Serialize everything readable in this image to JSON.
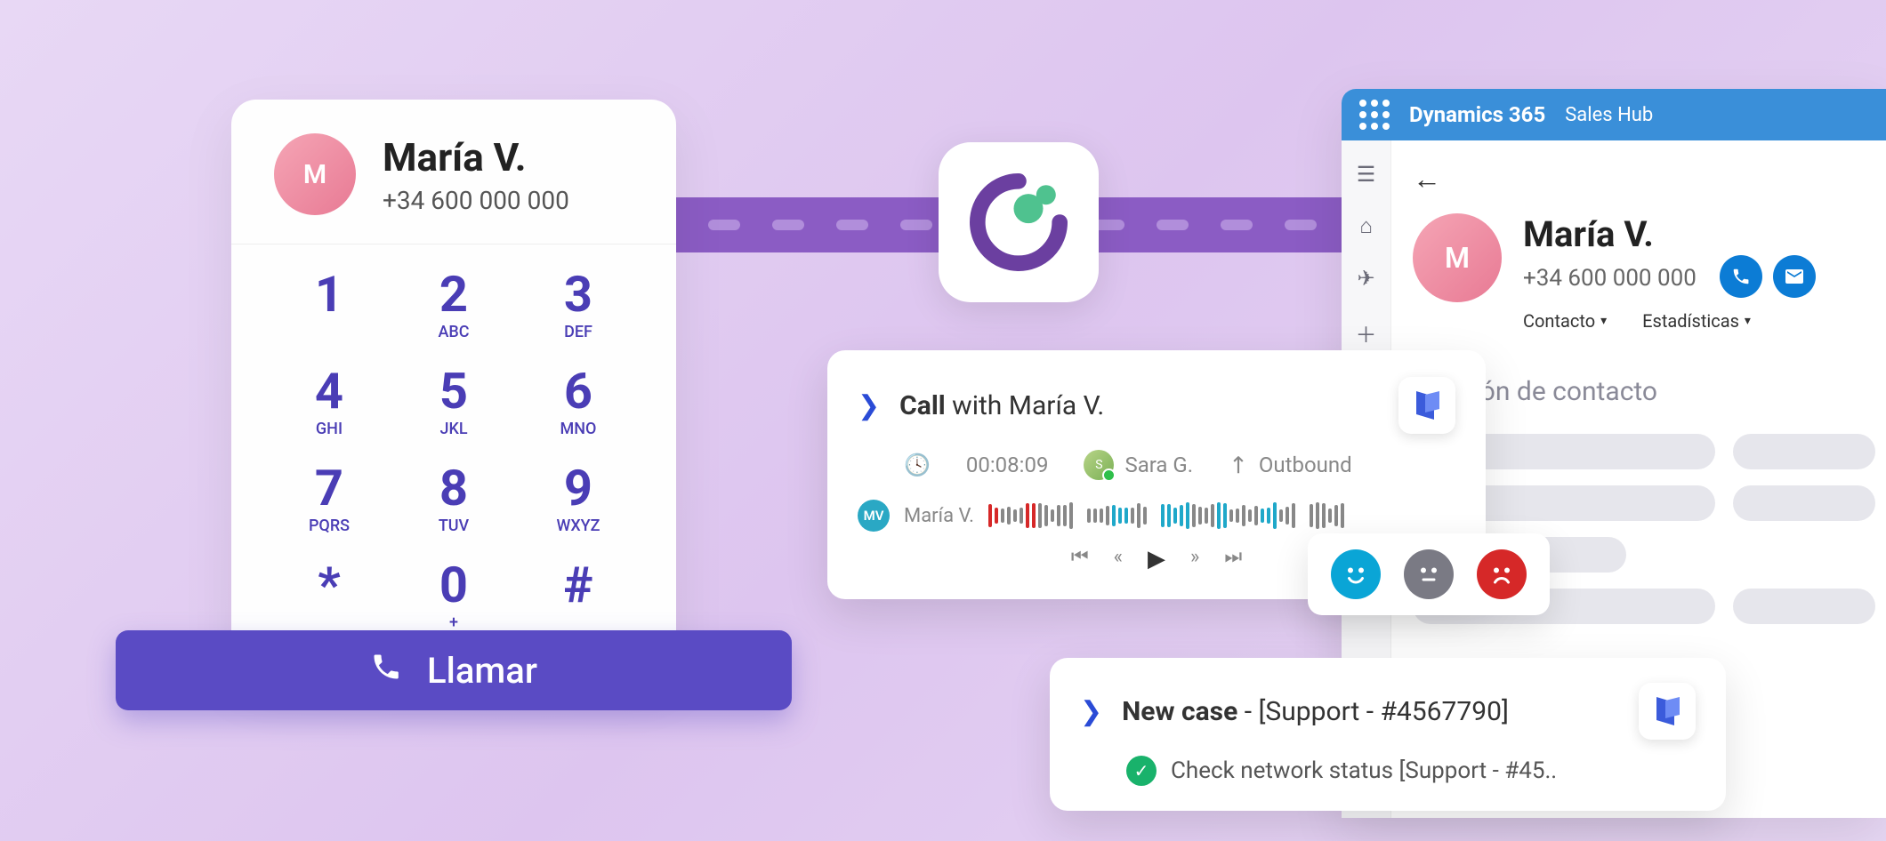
{
  "dialer": {
    "contact_name": "María V.",
    "contact_phone": "+34 600 000 000",
    "keys": [
      {
        "digit": "1",
        "letters": ""
      },
      {
        "digit": "2",
        "letters": "ABC"
      },
      {
        "digit": "3",
        "letters": "DEF"
      },
      {
        "digit": "4",
        "letters": "GHI"
      },
      {
        "digit": "5",
        "letters": "JKL"
      },
      {
        "digit": "6",
        "letters": "MNO"
      },
      {
        "digit": "7",
        "letters": "PQRS"
      },
      {
        "digit": "8",
        "letters": "TUV"
      },
      {
        "digit": "9",
        "letters": "WXYZ"
      },
      {
        "digit": "*",
        "letters": ""
      },
      {
        "digit": "0",
        "letters": "+"
      },
      {
        "digit": "#",
        "letters": ""
      }
    ],
    "call_label": "Llamar"
  },
  "dynamics": {
    "product": "Dynamics 365",
    "area": "Sales Hub",
    "contact_name": "María V.",
    "contact_phone": "+34 600 000 000",
    "tabs": [
      "Contacto",
      "Estadísticas"
    ],
    "section_title": "rmación de contacto"
  },
  "call_card": {
    "title_bold": "Call",
    "title_rest": " with María V.",
    "duration": "00:08:09",
    "agent": "Sara G.",
    "direction": "Outbound",
    "participant_badge": "MV",
    "participant_name": "María V."
  },
  "case_card": {
    "title_bold": "New case",
    "title_rest": " - [Support - #4567790]",
    "sub": "Check network status [Support - #45.."
  },
  "colors": {
    "primary_purple": "#5a4bc4",
    "dynamics_blue": "#3a8fd9",
    "action_blue": "#0c7cd5"
  }
}
